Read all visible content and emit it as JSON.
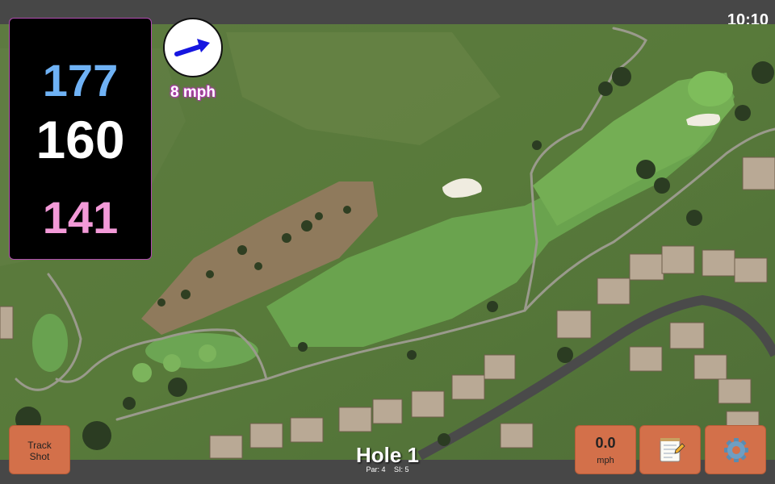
{
  "status": {
    "time": "10:10"
  },
  "distances": {
    "back": "177",
    "center": "160",
    "front": "141"
  },
  "wind": {
    "speed": "8 mph",
    "icon": "wind-arrow-icon"
  },
  "hole": {
    "title": "Hole 1",
    "par": "Par: 4",
    "si": "SI: 5"
  },
  "buttons": {
    "track_shot": "Track\nShot",
    "speed_value": "0.0",
    "speed_unit": "mph",
    "notes_icon": "notepad-icon",
    "settings_icon": "gear-icon"
  },
  "colors": {
    "back": "#6fb2f5",
    "center": "#ffffff",
    "front": "#f39ad8",
    "button": "#d3704a"
  }
}
